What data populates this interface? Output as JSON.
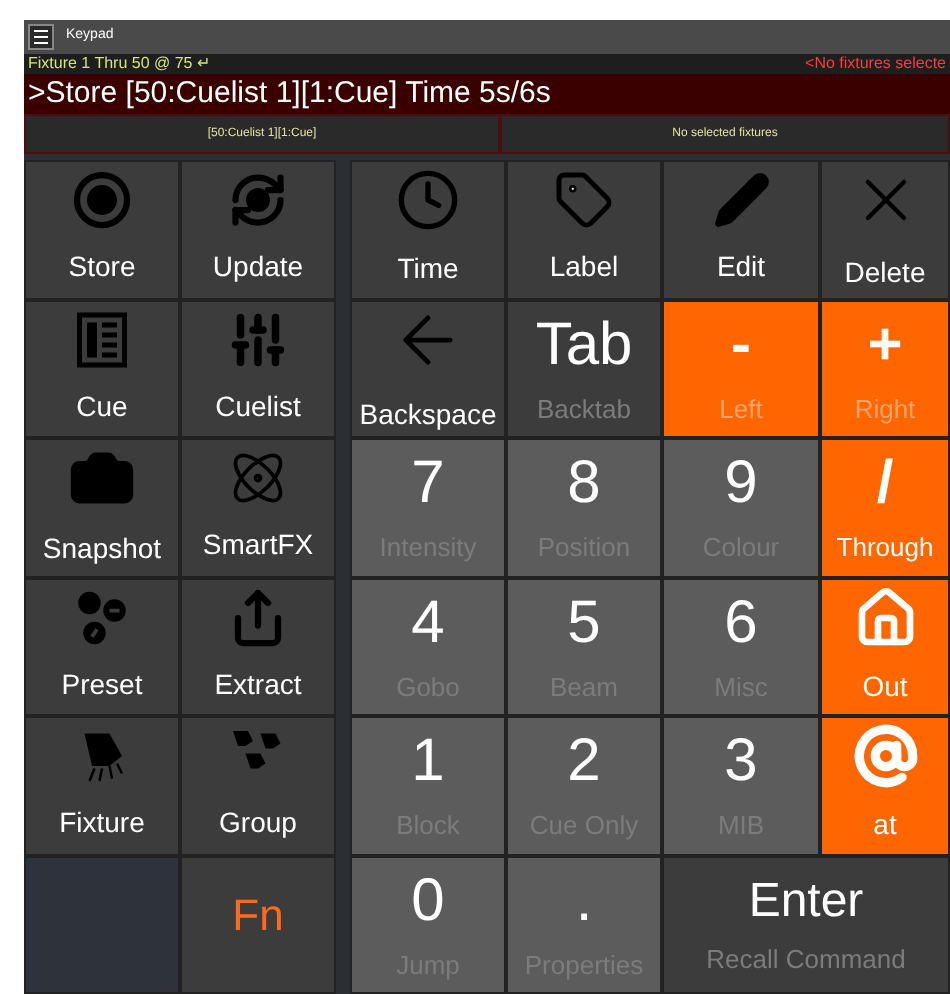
{
  "window": {
    "title": "Keypad"
  },
  "status": {
    "command_history": "Fixture 1 Thru 50 @ 75 ↵",
    "selection_message": "<No fixtures selecte"
  },
  "command_line": ">Store [50:Cuelist 1][1:Cue] Time 5s/6s",
  "info_panels": [
    "[50:Cuelist 1][1:Cue]",
    "No selected fixtures"
  ],
  "rows": [
    {
      "left": [
        {
          "kind": "icon",
          "label": "Store"
        },
        {
          "kind": "icon",
          "label": "Update"
        }
      ],
      "right": [
        {
          "kind": "icon",
          "label": "Time",
          "accent": false,
          "dimmed": false
        },
        {
          "kind": "icon",
          "label": "Label",
          "accent": false,
          "dimmed": false
        },
        {
          "kind": "icon",
          "label": "Edit",
          "accent": false,
          "dimmed": false
        },
        {
          "kind": "icon",
          "label": "Delete",
          "accent": false,
          "dimmed": false
        }
      ]
    },
    {
      "left": [
        {
          "kind": "icon",
          "label": "Cue"
        },
        {
          "kind": "icon",
          "label": "Cuelist"
        }
      ],
      "right": [
        {
          "kind": "icon",
          "label": "Backspace",
          "accent": false,
          "dimmed": false
        },
        {
          "kind": "glyph",
          "symbol": "Tab",
          "label": "Backtab",
          "accent": false,
          "dimmed": true
        },
        {
          "kind": "glyph",
          "symbol": "-",
          "label": "Left",
          "accent": true,
          "dimmed": true
        },
        {
          "kind": "glyph",
          "symbol": "+",
          "label": "Right",
          "accent": true,
          "dimmed": true
        }
      ]
    },
    {
      "left": [
        {
          "kind": "icon",
          "label": "Snapshot"
        },
        {
          "kind": "icon",
          "label": "SmartFX"
        }
      ],
      "right": [
        {
          "kind": "glyph",
          "symbol": "7",
          "label": "Intensity",
          "accent": false,
          "dimmed": true
        },
        {
          "kind": "glyph",
          "symbol": "8",
          "label": "Position",
          "accent": false,
          "dimmed": true
        },
        {
          "kind": "glyph",
          "symbol": "9",
          "label": "Colour",
          "accent": false,
          "dimmed": true
        },
        {
          "kind": "glyph",
          "symbol": "/",
          "label": "Through",
          "accent": true,
          "dimmed": false
        }
      ]
    },
    {
      "left": [
        {
          "kind": "icon",
          "label": "Preset"
        },
        {
          "kind": "icon",
          "label": "Extract"
        }
      ],
      "right": [
        {
          "kind": "glyph",
          "symbol": "4",
          "label": "Gobo",
          "accent": false,
          "dimmed": true
        },
        {
          "kind": "glyph",
          "symbol": "5",
          "label": "Beam",
          "accent": false,
          "dimmed": true
        },
        {
          "kind": "glyph",
          "symbol": "6",
          "label": "Misc",
          "accent": false,
          "dimmed": true
        },
        {
          "kind": "icon",
          "label": "Out",
          "accent": true,
          "dimmed": false
        }
      ]
    },
    {
      "left": [
        {
          "kind": "icon",
          "label": "Fixture"
        },
        {
          "kind": "icon",
          "label": "Group"
        }
      ],
      "right": [
        {
          "kind": "glyph",
          "symbol": "1",
          "label": "Block",
          "accent": false,
          "dimmed": true
        },
        {
          "kind": "glyph",
          "symbol": "2",
          "label": "Cue Only",
          "accent": false,
          "dimmed": true
        },
        {
          "kind": "glyph",
          "symbol": "3",
          "label": "MIB",
          "accent": false,
          "dimmed": true
        },
        {
          "kind": "icon",
          "label": "at",
          "accent": true,
          "dimmed": false
        }
      ]
    },
    {
      "left": [
        {
          "kind": "blank"
        },
        {
          "kind": "function",
          "label": "Fn"
        }
      ],
      "right": [
        {
          "kind": "glyph",
          "symbol": "0",
          "label": "Jump",
          "accent": false,
          "dimmed": true
        },
        {
          "kind": "glyph",
          "symbol": ".",
          "label": "Properties",
          "accent": false,
          "dimmed": true
        },
        {
          "kind": "wide",
          "symbol": "Enter",
          "label": "Recall Command",
          "accent": false,
          "dimmed": true
        }
      ]
    }
  ]
}
